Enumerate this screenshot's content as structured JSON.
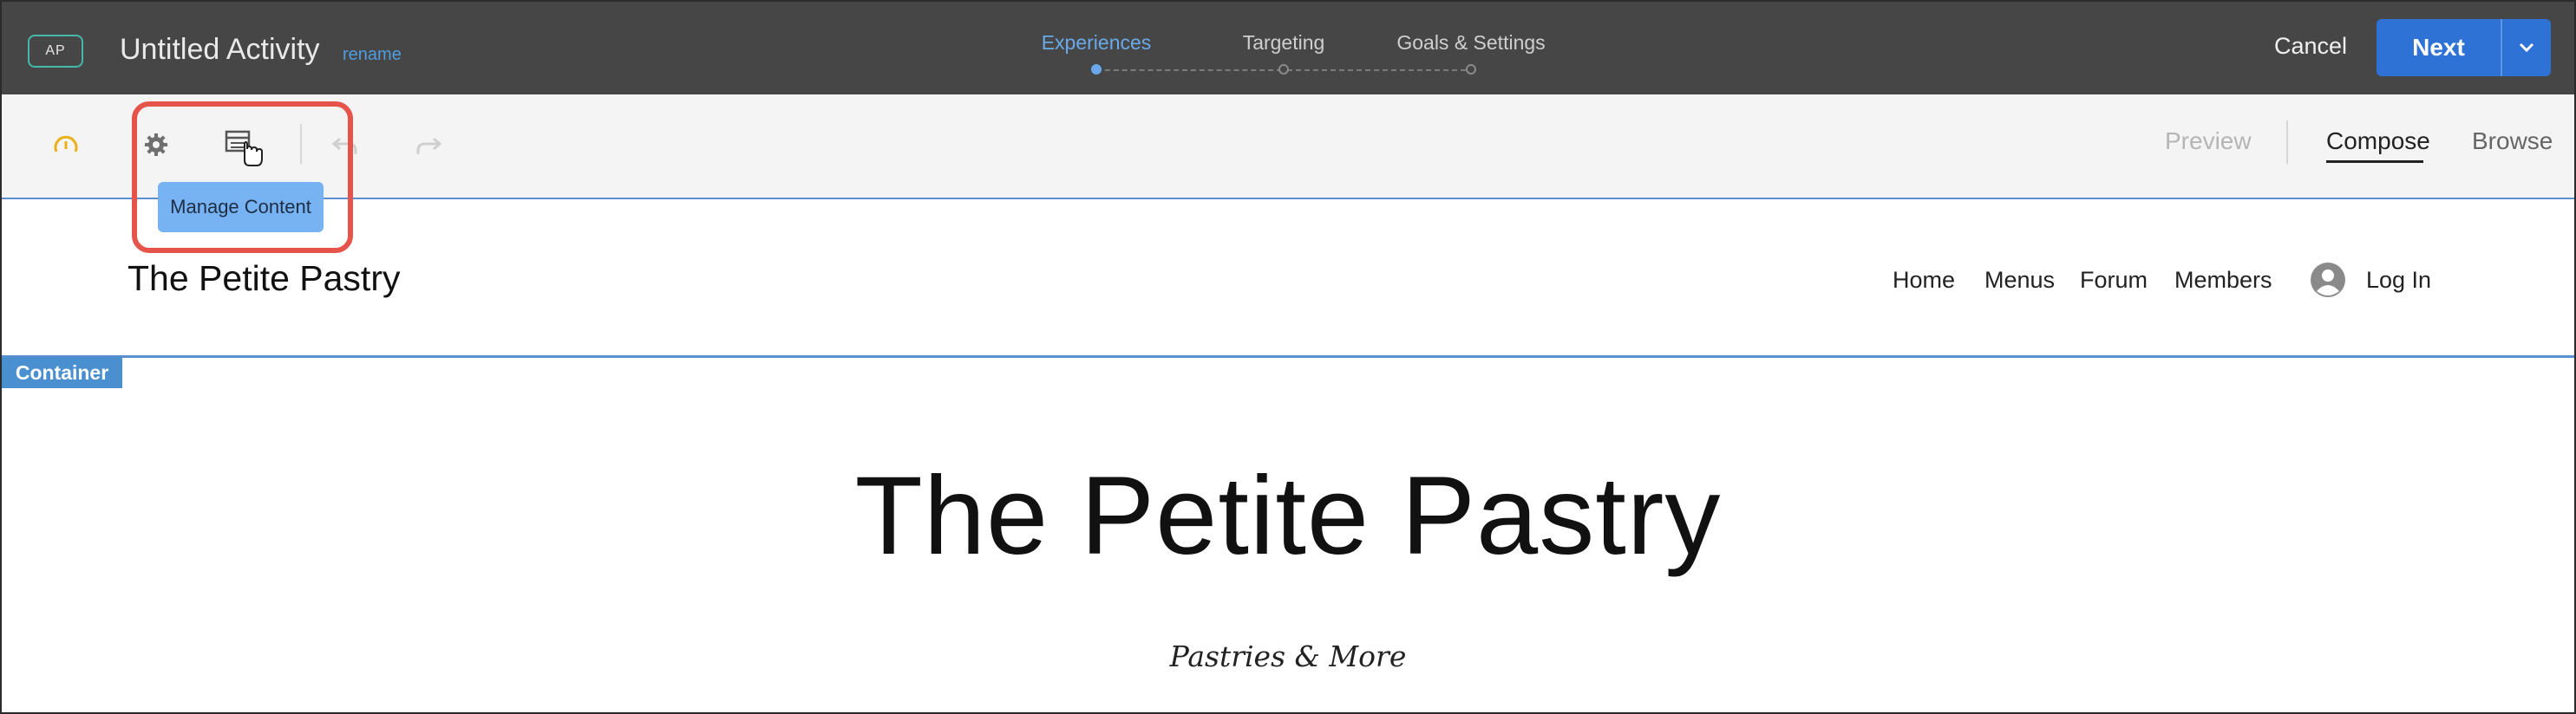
{
  "header": {
    "badge": "AP",
    "title": "Untitled Activity",
    "rename": "rename",
    "steps": [
      {
        "label": "Experiences",
        "active": true
      },
      {
        "label": "Targeting",
        "active": false
      },
      {
        "label": "Goals & Settings",
        "active": false
      }
    ],
    "cancel_label": "Cancel",
    "next_label": "Next"
  },
  "toolbar": {
    "icons": [
      "gauge-icon",
      "gear-icon",
      "manage-content-icon",
      "undo-icon",
      "redo-icon"
    ],
    "tooltip": "Manage Content",
    "modes": [
      "Preview",
      "Compose",
      "Browse"
    ],
    "active_mode": "Compose"
  },
  "site": {
    "logo": "The Petite Pastry",
    "nav": [
      "Home",
      "Menus",
      "Forum",
      "Members"
    ],
    "login": "Log In",
    "container_label": "Container",
    "hero_title": "The Petite Pastry",
    "hero_subtitle": "Pastries & More"
  },
  "colors": {
    "header_bg": "#464646",
    "accent_blue": "#2f72d6",
    "highlight_red": "#e5534b",
    "active_step": "#6aa9e8"
  }
}
